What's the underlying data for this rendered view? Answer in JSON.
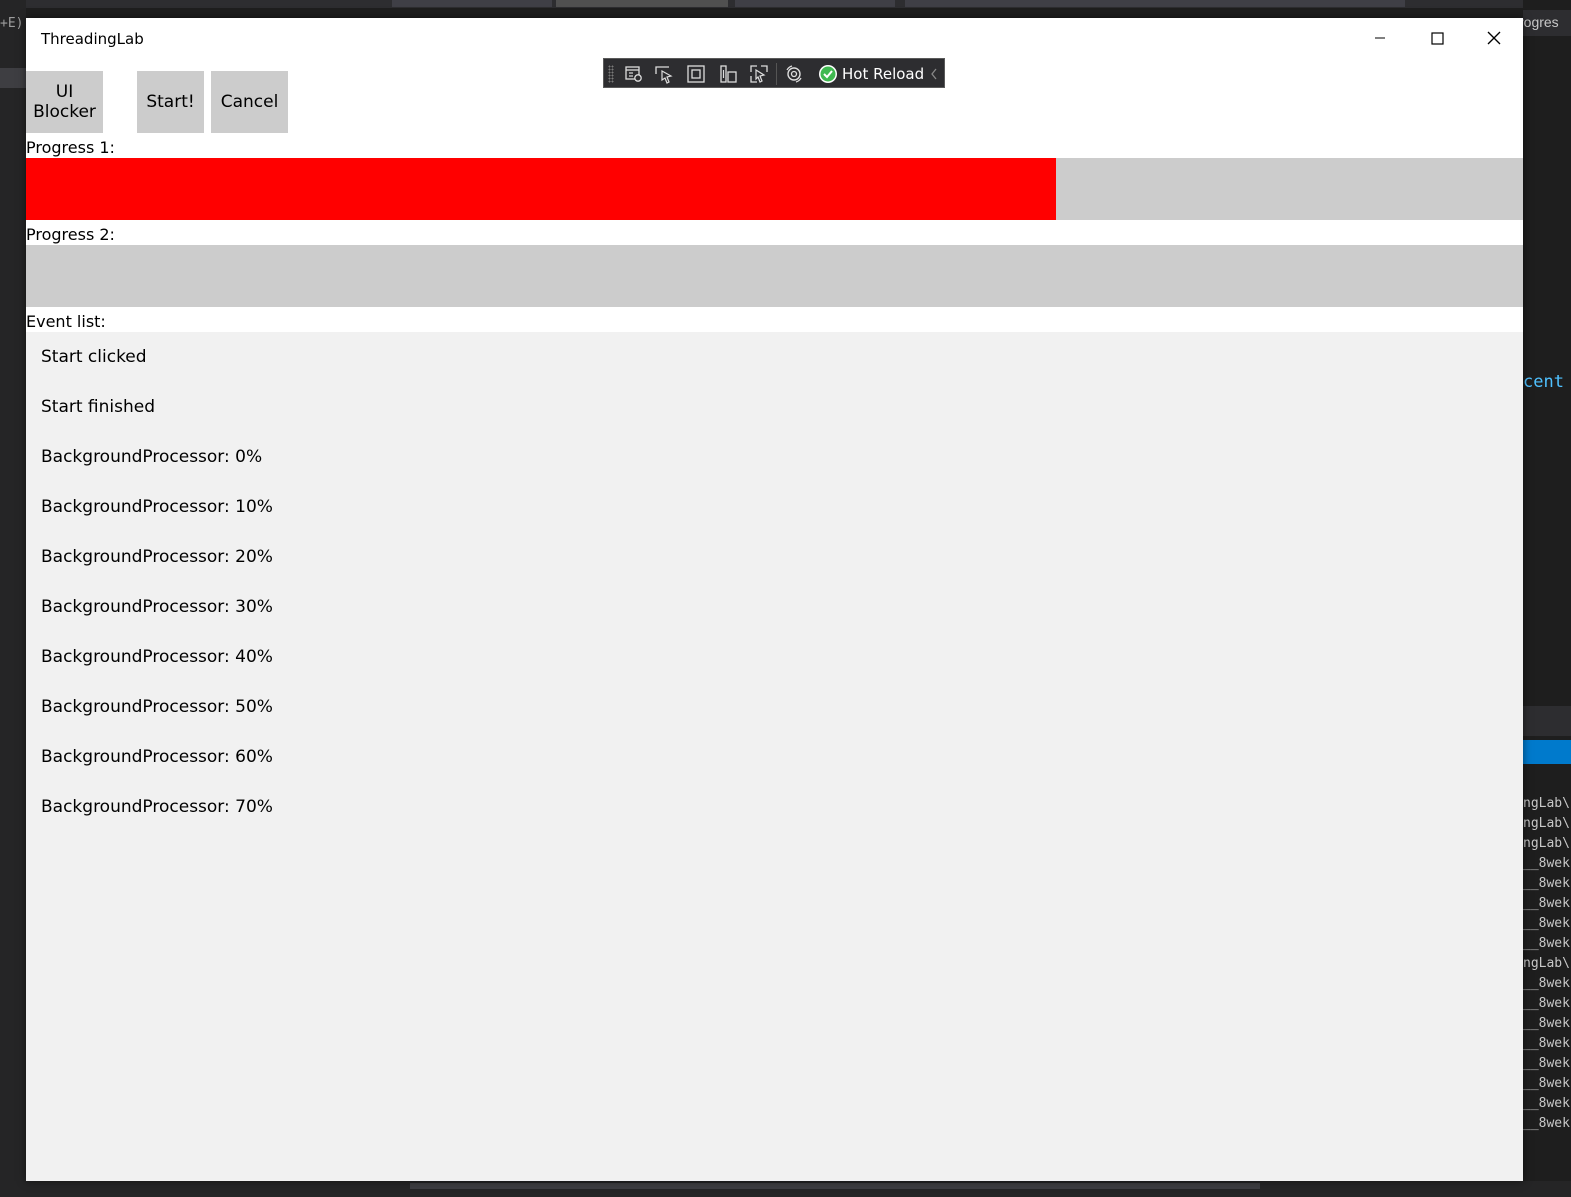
{
  "window": {
    "title": "ThreadingLab"
  },
  "toolbar": {
    "hot_reload_label": "Hot Reload",
    "tools": [
      "go-to-live-visual-tree-icon",
      "select-element-icon",
      "display-layout-adorners-icon",
      "track-focused-element-icon",
      "display-layout-adorners-hover-icon",
      "hot-reload-settings-icon"
    ]
  },
  "buttons": {
    "ui_blocker": "UI Blocker",
    "start": "Start!",
    "cancel": "Cancel"
  },
  "progress1": {
    "label": "Progress 1:",
    "value": 0.688,
    "color": "#ff0000"
  },
  "progress2": {
    "label": "Progress 2:",
    "value": 0,
    "color": "#ff0000"
  },
  "events": {
    "label": "Event list:",
    "items": [
      "Start clicked",
      "Start finished",
      "BackgroundProcessor: 0%",
      "BackgroundProcessor: 10%",
      "BackgroundProcessor: 20%",
      "BackgroundProcessor: 30%",
      "BackgroundProcessor: 40%",
      "BackgroundProcessor: 50%",
      "BackgroundProcessor: 60%",
      "BackgroundProcessor: 70%"
    ]
  },
  "ide_background": {
    "left_text": "+E)",
    "right_top_text": "rogres",
    "right_code_text": "cent",
    "output_lines": [
      "ngLab\\",
      "ngLab\\",
      "ngLab\\",
      "__8wek",
      "__8wek",
      "__8wek",
      "__8wek",
      "__8wek",
      "ngLab\\",
      "__8wek",
      "__8wek",
      "__8wek",
      "__8wek",
      "__8wek",
      "__8wek",
      "__8wek",
      "__8wek"
    ]
  },
  "colors": {
    "progress_track": "#cccccc",
    "event_list_bg": "#f1f1f1",
    "ide_bg": "#1e1e1e",
    "ide_accent": "#007acc",
    "hot_reload_ok": "#3fb950"
  }
}
